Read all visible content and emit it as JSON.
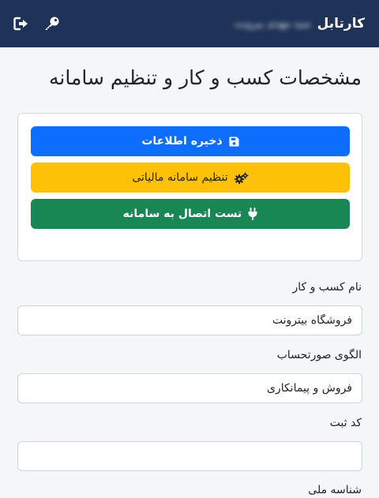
{
  "navbar": {
    "brand": "کارتابل",
    "user_name": "سید مهدی بیرونت",
    "icons": [
      "logout-icon",
      "key-icon"
    ]
  },
  "page": {
    "title": "مشخصات کسب و کار و تنظیم سامانه"
  },
  "actions": {
    "save_label": "ذخیره اطلاعات",
    "tax_settings_label": "تنظیم سامانه مالیاتی",
    "test_connection_label": "تست اتصال به سامانه",
    "colors": {
      "save": "#0d6efd",
      "tax": "#ffc107",
      "test": "#198754"
    }
  },
  "form": {
    "business_name": {
      "label": "نام کسب و کار",
      "value": "فروشگاه بیترونت"
    },
    "invoice_pattern": {
      "label": "الگوی صورتحساب",
      "value": "فروش و پیمانکاری"
    },
    "registration_code": {
      "label": "کد ثبت",
      "value": ""
    },
    "national_id": {
      "label": "شناسه ملی"
    }
  }
}
